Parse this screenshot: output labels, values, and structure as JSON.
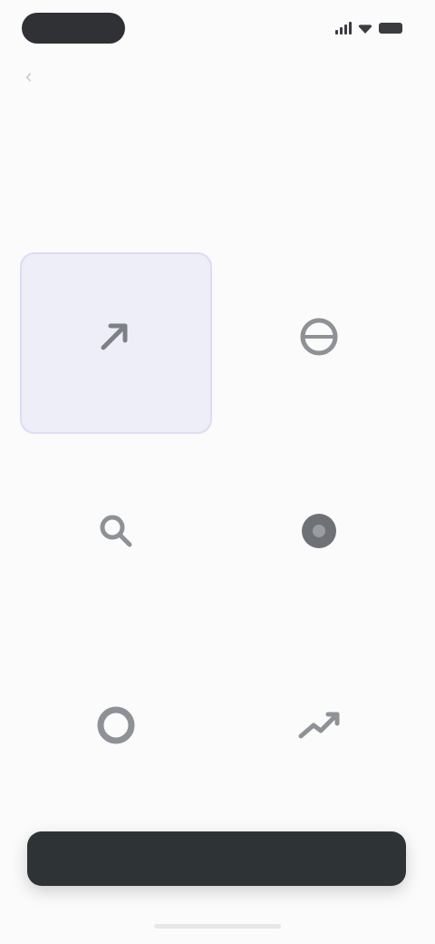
{
  "header": {
    "back_label": "‹",
    "title": "",
    "action_label": ""
  },
  "step_label": "",
  "page_title": "",
  "page_subtitle": "",
  "options": [
    {
      "label": "",
      "icon": "arrow-up-right-icon",
      "selected": true
    },
    {
      "label": "",
      "icon": "circle-globe-icon",
      "selected": false
    },
    {
      "label": "",
      "icon": "search-icon",
      "selected": false
    },
    {
      "label": "",
      "icon": "filled-circle-icon",
      "selected": false
    },
    {
      "label": "",
      "icon": "ring-icon",
      "selected": false
    },
    {
      "label": "",
      "icon": "trend-up-icon",
      "selected": false
    }
  ],
  "primary_button": {
    "label": ""
  },
  "colors": {
    "accent": "#e3b79a",
    "selected_bg": "#eeeef9",
    "button_bg": "#2e3336"
  }
}
